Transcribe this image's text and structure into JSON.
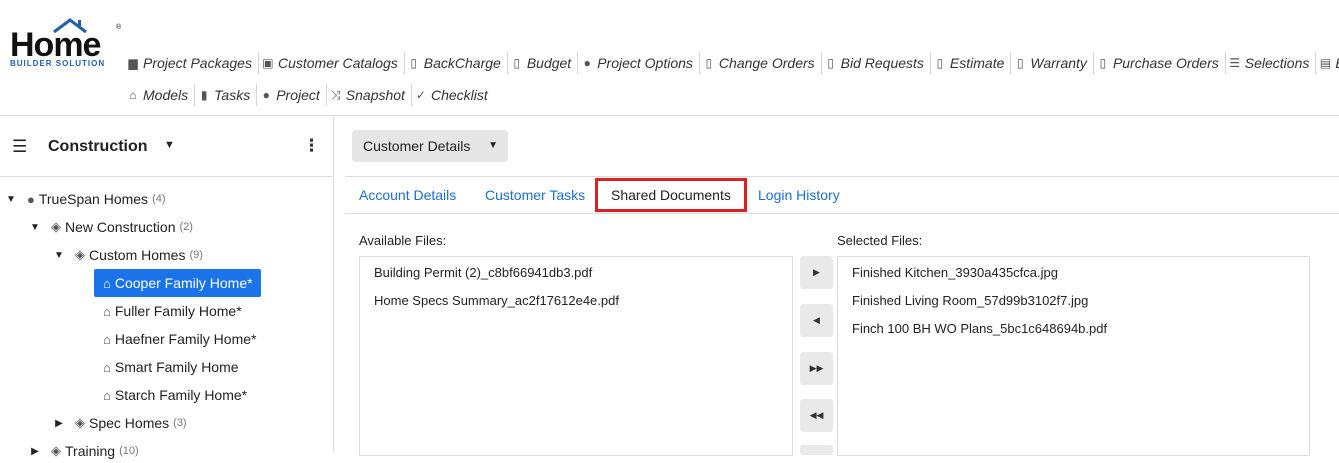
{
  "logo": {
    "word": "Home",
    "tagline": "BUILDER SOLUTION",
    "reg": "®"
  },
  "nav": {
    "row1": [
      {
        "label": "Project Packages",
        "icon": "package-icon"
      },
      {
        "label": "Customer Catalogs",
        "icon": "catalog-icon"
      },
      {
        "label": "BackCharge",
        "icon": "document-icon"
      },
      {
        "label": "Budget",
        "icon": "document-icon"
      },
      {
        "label": "Project Options",
        "icon": "user-icon"
      },
      {
        "label": "Change Orders",
        "icon": "document-icon"
      },
      {
        "label": "Bid Requests",
        "icon": "document-icon"
      },
      {
        "label": "Estimate",
        "icon": "document-icon"
      },
      {
        "label": "Warranty",
        "icon": "document-icon"
      },
      {
        "label": "Purchase Orders",
        "icon": "document-icon"
      },
      {
        "label": "Selections",
        "icon": "checklist-icon"
      },
      {
        "label": "Bi",
        "icon": "list-icon"
      }
    ],
    "row2": [
      {
        "label": "Models",
        "icon": "home-icon"
      },
      {
        "label": "Tasks",
        "icon": "clipboard-icon"
      },
      {
        "label": "Project",
        "icon": "user-icon"
      },
      {
        "label": "Snapshot",
        "icon": "shuffle-icon"
      },
      {
        "label": "Checklist",
        "icon": "check-icon"
      }
    ]
  },
  "sidebar": {
    "title": "Construction",
    "tree": [
      {
        "label": "TrueSpan Homes",
        "count": "(4)",
        "icon": "user-icon",
        "toggle": "▼"
      },
      {
        "label": "New Construction",
        "count": "(2)",
        "icon": "map-icon",
        "toggle": "▼"
      },
      {
        "label": "Custom Homes",
        "count": "(9)",
        "icon": "map-icon",
        "toggle": "▼"
      },
      {
        "label": "Cooper Family Home*",
        "count": "",
        "icon": "home-icon",
        "toggle": ""
      },
      {
        "label": "Fuller Family Home*",
        "count": "",
        "icon": "home-icon",
        "toggle": ""
      },
      {
        "label": "Haefner Family Home*",
        "count": "",
        "icon": "home-icon",
        "toggle": ""
      },
      {
        "label": "Smart Family Home",
        "count": "",
        "icon": "home-icon",
        "toggle": ""
      },
      {
        "label": "Starch Family Home*",
        "count": "",
        "icon": "home-icon",
        "toggle": ""
      },
      {
        "label": "Spec Homes",
        "count": "(3)",
        "icon": "map-icon",
        "toggle": "▶"
      },
      {
        "label": "Training",
        "count": "(10)",
        "icon": "map-icon",
        "toggle": "▶"
      }
    ]
  },
  "main": {
    "dropdown": "Customer Details",
    "tabs": [
      "Account Details",
      "Customer Tasks",
      "Shared Documents",
      "Login History"
    ],
    "available_label": "Available Files:",
    "selected_label": "Selected Files:",
    "available_files": [
      "Building Permit (2)_c8bf66941db3.pdf",
      "Home Specs Summary_ac2f17612e4e.pdf"
    ],
    "selected_files": [
      "Finished Kitchen_3930a435cfca.jpg",
      "Finished Living Room_57d99b3102f7.jpg",
      "Finch 100 BH WO Plans_5bc1c648694b.pdf"
    ],
    "move_buttons": [
      "▶",
      "◀",
      "▶▶",
      "◀◀"
    ]
  }
}
